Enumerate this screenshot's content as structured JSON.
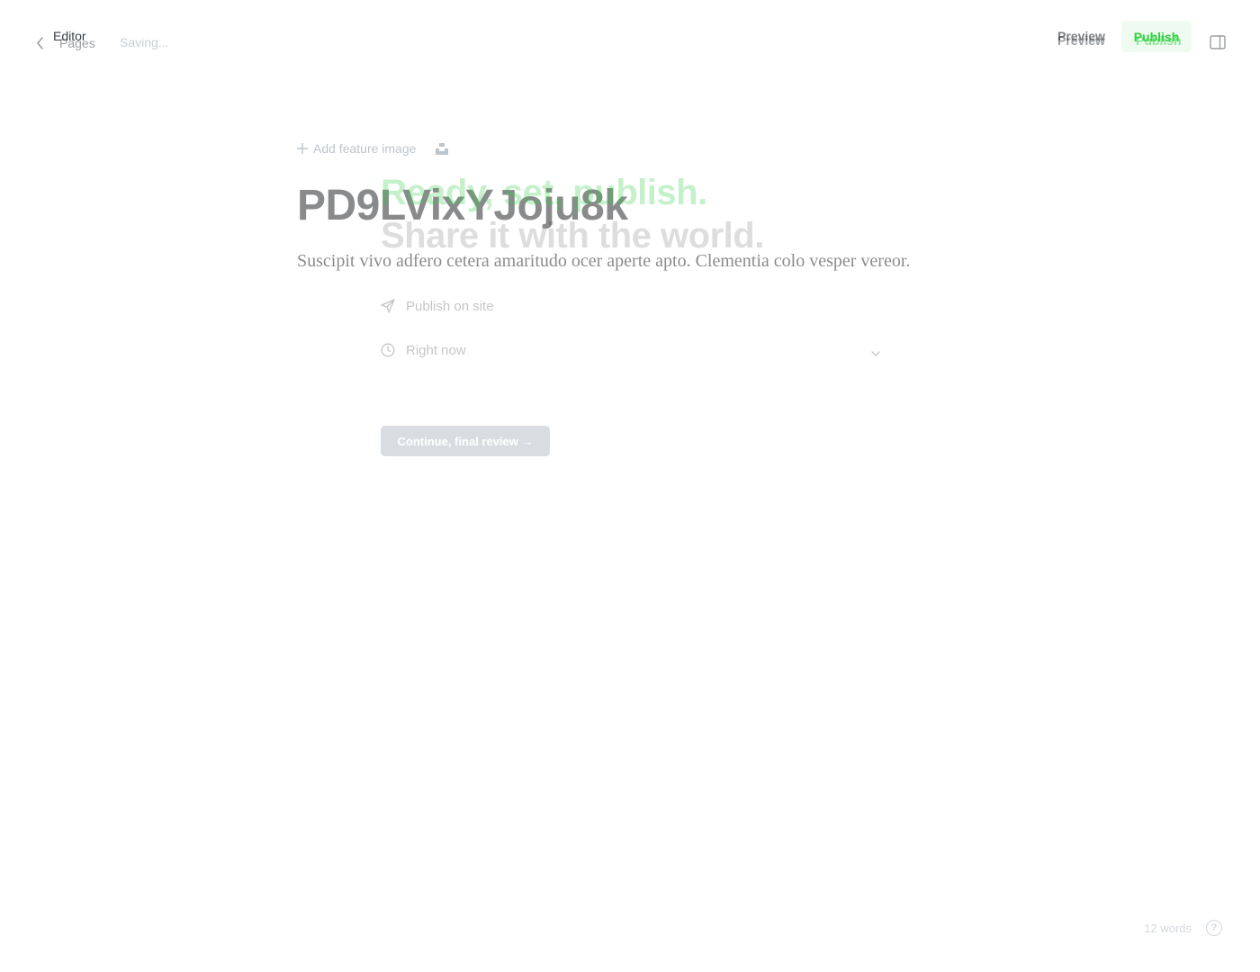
{
  "editor": {
    "back_label": "Pages",
    "status": "Saving...",
    "preview_label": "Preview",
    "publish_label": "Publish",
    "add_feature_image_label": "Add feature image",
    "post_title": "PD9LVixYJoju8k",
    "post_body": "Suscipit vivo adfero cetera amaritudo ocer aperte apto. Clementia colo vesper vereor.",
    "word_count": "12 words",
    "help_label": "?"
  },
  "publish_modal": {
    "back_label": "Editor",
    "preview_label": "Preview",
    "publish_label": "Publish",
    "headline_line1": "Ready, set, publish.",
    "headline_line2": "Share it with the world.",
    "option_publish_on": "Publish on site",
    "option_schedule": "Right now",
    "continue_label": "Continue, final review →"
  },
  "colors": {
    "accent_green": "#30cf43",
    "text_dark": "#15171a",
    "text_muted": "#8e9cac"
  }
}
